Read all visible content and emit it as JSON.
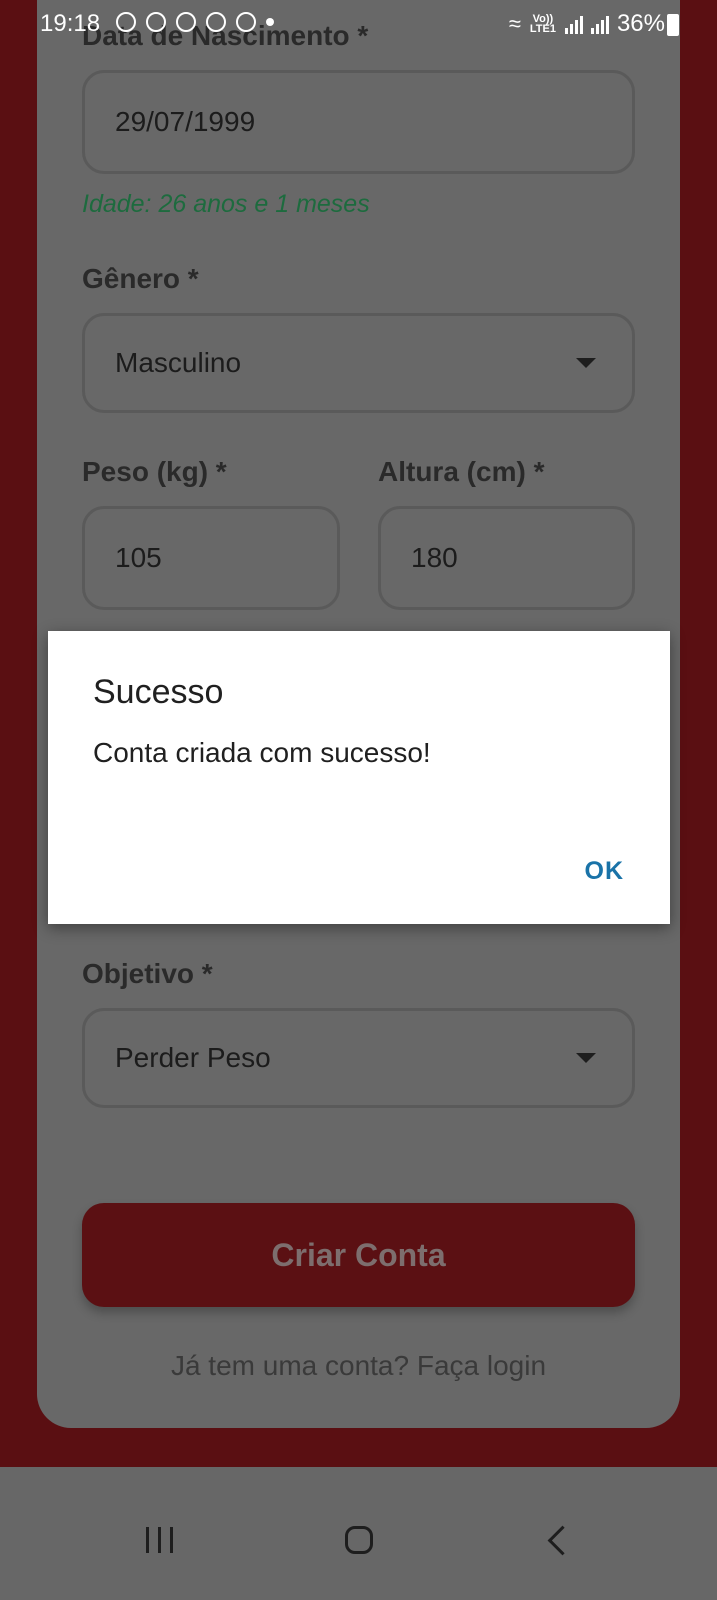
{
  "status_bar": {
    "time": "19:18",
    "network": "Vo)) LTE1",
    "battery": "36%"
  },
  "form": {
    "birth_label": "Data de Nascimento *",
    "birth_value": "29/07/1999",
    "age_text": "Idade: 26 anos e 1 meses",
    "gender_label": "Gênero *",
    "gender_value": "Masculino",
    "weight_label": "Peso (kg) *",
    "weight_value": "105",
    "height_label": "Altura (cm) *",
    "height_value": "180",
    "goal_label": "Objetivo *",
    "goal_value": "Perder Peso",
    "submit_label": "Criar Conta",
    "login_link": "Já tem uma conta? Faça login"
  },
  "dialog": {
    "title": "Sucesso",
    "message": "Conta criada com sucesso!",
    "ok_label": "OK"
  },
  "nav": {
    "recent_icon": "recent-apps-icon",
    "home_icon": "home-icon",
    "back_icon": "back-icon"
  },
  "colors": {
    "brand": "#8b1a1e",
    "success_text": "#1d6b3e",
    "dialog_accent": "#1a73a8"
  }
}
